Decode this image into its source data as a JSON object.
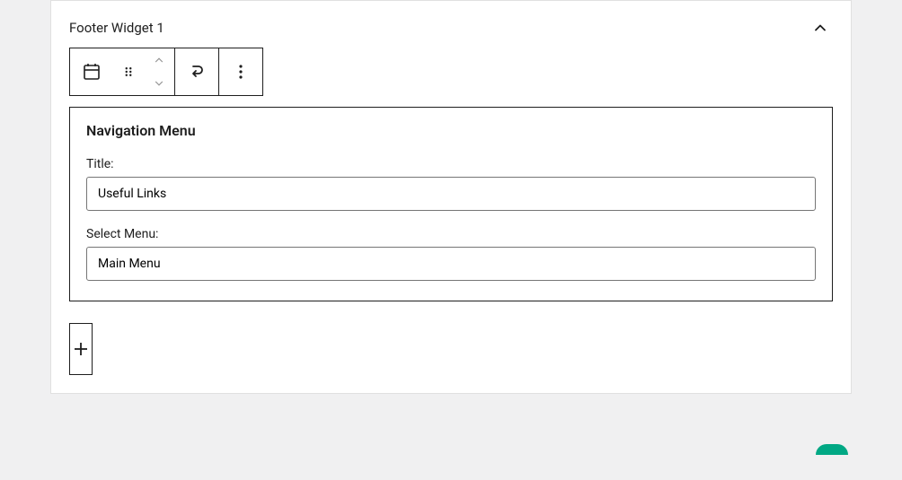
{
  "panel": {
    "title": "Footer Widget 1"
  },
  "widget": {
    "heading": "Navigation Menu",
    "title_label": "Title:",
    "title_value": "Useful Links",
    "menu_label": "Select Menu:",
    "menu_value": "Main Menu"
  }
}
